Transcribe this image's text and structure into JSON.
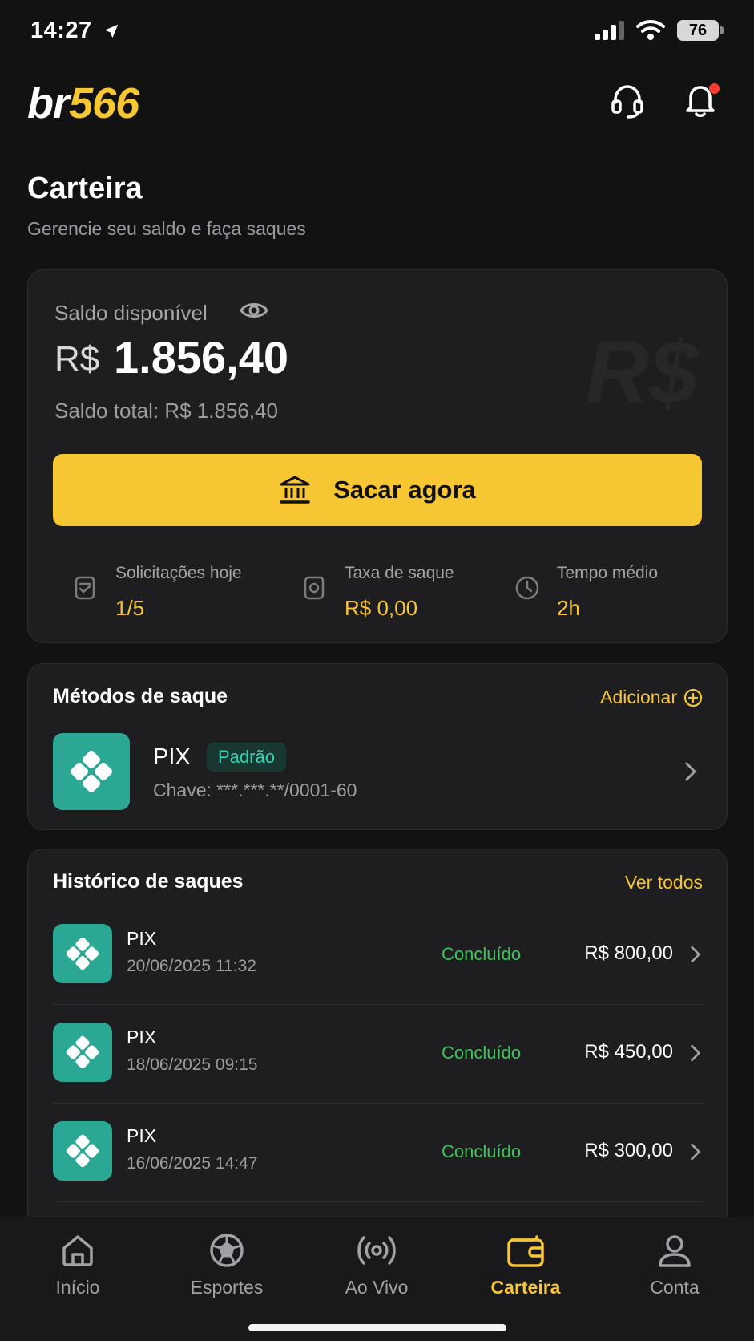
{
  "status_bar": {
    "time": "14:27",
    "battery": "76"
  },
  "header": {
    "logo_part1": "br",
    "logo_part2": "566",
    "title": "Carteira",
    "subtitle": "Gerencie seu saldo e faça saques"
  },
  "balance": {
    "label": "Saldo disponível",
    "currency": "R$",
    "amount": "1.856,40",
    "watermark": "R$",
    "total": "Saldo total: R$ 1.856,40",
    "withdraw_button": "Sacar agora",
    "stats": [
      {
        "label": "Solicitações hoje",
        "value": "1/5"
      },
      {
        "label": "Taxa de saque",
        "value": "R$ 0,00"
      },
      {
        "label": "Tempo médio",
        "value": "2h"
      }
    ]
  },
  "methods": {
    "title": "Métodos de saque",
    "add_label": "Adicionar",
    "items": [
      {
        "name": "PIX",
        "badge": "Padrão",
        "key": "Chave: ***.***.**/0001-60"
      }
    ]
  },
  "history": {
    "title": "Histórico de saques",
    "view_all": "Ver todos",
    "items": [
      {
        "method": "PIX",
        "date": "20/06/2025 11:32",
        "status": "Concluído",
        "amount": "R$ 800,00"
      },
      {
        "method": "PIX",
        "date": "18/06/2025 09:15",
        "status": "Concluído",
        "amount": "R$ 450,00"
      },
      {
        "method": "PIX",
        "date": "16/06/2025 14:47",
        "status": "Concluído",
        "amount": "R$ 300,00"
      }
    ]
  },
  "nav": {
    "items": [
      {
        "label": "Início",
        "icon": "home-icon"
      },
      {
        "label": "Esportes",
        "icon": "soccer-ball-icon"
      },
      {
        "label": "Ao Vivo",
        "icon": "live-broadcast-icon"
      },
      {
        "label": "Carteira",
        "icon": "wallet-icon"
      },
      {
        "label": "Conta",
        "icon": "user-icon"
      }
    ],
    "active": "Carteira"
  },
  "colors": {
    "background": "#121213",
    "card": "#1e1e20",
    "accent": "#f6c633",
    "pix": "#2aa893",
    "success": "#3fc35a",
    "notification": "#ff3b30"
  }
}
